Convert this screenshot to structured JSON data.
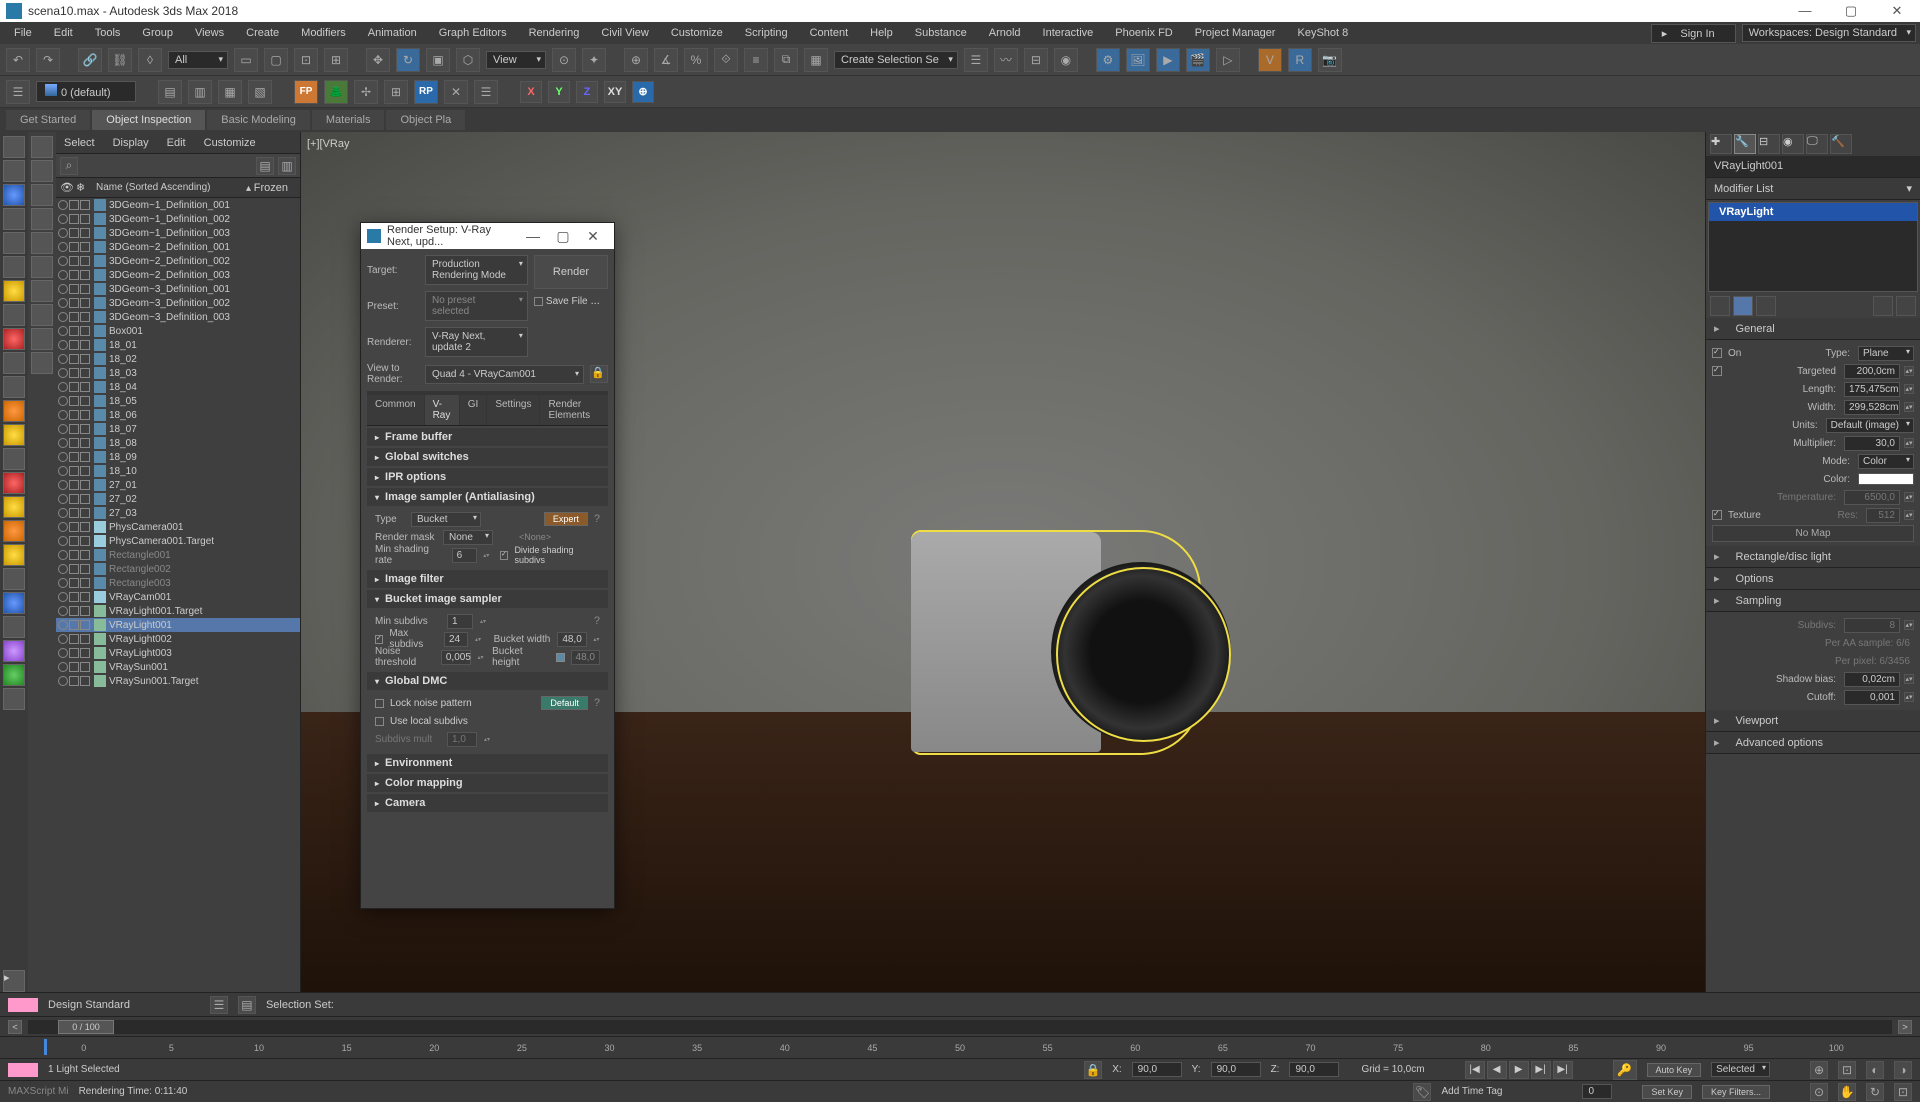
{
  "title": "scena10.max - Autodesk 3ds Max 2018",
  "menu": [
    "File",
    "Edit",
    "Tools",
    "Group",
    "Views",
    "Create",
    "Modifiers",
    "Animation",
    "Graph Editors",
    "Rendering",
    "Civil View",
    "Customize",
    "Scripting",
    "Content",
    "Help",
    "Substance",
    "Arnold",
    "Interactive",
    "Phoenix FD",
    "Project Manager",
    "KeyShot 8"
  ],
  "signin": "Sign In",
  "workspaces": "Workspaces: Design Standard",
  "toolbar": {
    "all": "All",
    "view": "View",
    "createsel": "Create Selection Se"
  },
  "layer_default": "0 (default)",
  "ribbon_tabs": [
    "Get Started",
    "Object Inspection",
    "Basic Modeling",
    "Materials",
    "Object Pla"
  ],
  "ribbon_active": "Object Inspection",
  "scene": {
    "menus": [
      "Select",
      "Display",
      "Edit",
      "Customize"
    ],
    "col_name": "Name (Sorted Ascending)",
    "col_frozen": "Frozen",
    "items": [
      {
        "n": "3DGeom~1_Definition_001",
        "t": "geom"
      },
      {
        "n": "3DGeom~1_Definition_002",
        "t": "geom"
      },
      {
        "n": "3DGeom~1_Definition_003",
        "t": "geom"
      },
      {
        "n": "3DGeom~2_Definition_001",
        "t": "geom"
      },
      {
        "n": "3DGeom~2_Definition_002",
        "t": "geom"
      },
      {
        "n": "3DGeom~2_Definition_003",
        "t": "geom"
      },
      {
        "n": "3DGeom~3_Definition_001",
        "t": "geom"
      },
      {
        "n": "3DGeom~3_Definition_002",
        "t": "geom"
      },
      {
        "n": "3DGeom~3_Definition_003",
        "t": "geom"
      },
      {
        "n": "Box001",
        "t": "geom"
      },
      {
        "n": "18_01",
        "t": "geom"
      },
      {
        "n": "18_02",
        "t": "geom"
      },
      {
        "n": "18_03",
        "t": "geom"
      },
      {
        "n": "18_04",
        "t": "geom"
      },
      {
        "n": "18_05",
        "t": "geom"
      },
      {
        "n": "18_06",
        "t": "geom"
      },
      {
        "n": "18_07",
        "t": "geom"
      },
      {
        "n": "18_08",
        "t": "geom"
      },
      {
        "n": "18_09",
        "t": "geom"
      },
      {
        "n": "18_10",
        "t": "geom"
      },
      {
        "n": "27_01",
        "t": "geom"
      },
      {
        "n": "27_02",
        "t": "geom"
      },
      {
        "n": "27_03",
        "t": "geom"
      },
      {
        "n": "PhysCamera001",
        "t": "cam"
      },
      {
        "n": "PhysCamera001.Target",
        "t": "cam"
      },
      {
        "n": "Rectangle001",
        "t": "geom",
        "dim": true
      },
      {
        "n": "Rectangle002",
        "t": "geom",
        "dim": true
      },
      {
        "n": "Rectangle003",
        "t": "geom",
        "dim": true
      },
      {
        "n": "VRayCam001",
        "t": "cam"
      },
      {
        "n": "VRayLight001.Target",
        "t": "light"
      },
      {
        "n": "VRayLight001",
        "t": "light",
        "sel": true
      },
      {
        "n": "VRayLight002",
        "t": "light"
      },
      {
        "n": "VRayLight003",
        "t": "light"
      },
      {
        "n": "VRaySun001",
        "t": "light"
      },
      {
        "n": "VRaySun001.Target",
        "t": "light"
      }
    ]
  },
  "vp_label": "[+][VRay",
  "dialog": {
    "title": "Render Setup: V-Ray Next, upd...",
    "target_lbl": "Target:",
    "target": "Production Rendering Mode",
    "preset_lbl": "Preset:",
    "preset": "No preset selected",
    "renderer_lbl": "Renderer:",
    "renderer": "V-Ray Next, update 2",
    "view_lbl": "View to Render:",
    "view": "Quad 4 - VRayCam001",
    "render_btn": "Render",
    "savefile": "Save File",
    "tabs": [
      "Common",
      "V-Ray",
      "GI",
      "Settings",
      "Render Elements"
    ],
    "tab_active": "V-Ray",
    "rollouts": {
      "frame_buffer": "Frame buffer",
      "global_switches": "Global switches",
      "ipr": "IPR options",
      "img_sampler": "Image sampler (Antialiasing)",
      "img_filter": "Image filter",
      "bucket_sampler": "Bucket image sampler",
      "global_dmc": "Global DMC",
      "environment": "Environment",
      "color_mapping": "Color mapping",
      "camera": "Camera"
    },
    "img": {
      "type_lbl": "Type",
      "type": "Bucket",
      "expert": "Expert",
      "mask_lbl": "Render mask",
      "mask": "None",
      "none": "<None>",
      "minshade_lbl": "Min shading rate",
      "minshade": "6",
      "divide": "Divide shading subdivs"
    },
    "bucket": {
      "minsub_lbl": "Min subdivs",
      "minsub": "1",
      "maxsub_lbl": "Max subdivs",
      "maxsub": "24",
      "noise_lbl": "Noise threshold",
      "noise": "0,005",
      "bw_lbl": "Bucket width",
      "bw": "48,0",
      "bh_lbl": "Bucket height",
      "bh": "48,0"
    },
    "dmc": {
      "lock": "Lock noise pattern",
      "local": "Use local subdivs",
      "mult_lbl": "Subdivs mult",
      "mult": "1,0",
      "default": "Default"
    }
  },
  "right": {
    "objname": "VRayLight001",
    "modlist": "Modifier List",
    "moditem": "VRayLight",
    "general": "General",
    "rectlight": "Rectangle/disc light",
    "options": "Options",
    "sampling": "Sampling",
    "viewport": "Viewport",
    "advanced": "Advanced options",
    "on": "On",
    "type_lbl": "Type:",
    "type": "Plane",
    "targeted": "Targeted",
    "targeted_v": "200,0cm",
    "length": "Length:",
    "length_v": "175,475cm",
    "width": "Width:",
    "width_v": "299,528cm",
    "units": "Units:",
    "units_v": "Default (image)",
    "mult": "Multiplier:",
    "mult_v": "30,0",
    "mode": "Mode:",
    "mode_v": "Color",
    "color": "Color:",
    "temp": "Temperature:",
    "temp_v": "6500,0",
    "texture": "Texture",
    "res": "Res:",
    "res_v": "512",
    "nomap": "No Map",
    "subdivs": "Subdivs:",
    "subdivs_v": "8",
    "peraa": "Per AA sample: 6/6",
    "perpx": "Per pixel: 6/3456",
    "shadow": "Shadow bias:",
    "shadow_v": "0,02cm",
    "cutoff": "Cutoff:",
    "cutoff_v": "0,001"
  },
  "bottom": {
    "design": "Design Standard",
    "selset": "Selection Set:",
    "slider": "0 / 100",
    "ticks": [
      "0",
      "5",
      "10",
      "15",
      "20",
      "25",
      "30",
      "35",
      "40",
      "45",
      "50",
      "55",
      "60",
      "65",
      "70",
      "75",
      "80",
      "85",
      "90",
      "95",
      "100"
    ],
    "status": "1 Light Selected",
    "x": "X:",
    "xv": "90,0",
    "y": "Y:",
    "yv": "90,0",
    "z": "Z:",
    "zv": "90,0",
    "grid": "Grid = 10,0cm",
    "autokey": "Auto Key",
    "selected": "Selected",
    "maxscript": "MAXScript Mi",
    "rendtime": "Rendering Time: 0:11:40",
    "timetag": "Add Time Tag",
    "setkey": "Set Key",
    "keyfilters": "Key Filters..."
  }
}
